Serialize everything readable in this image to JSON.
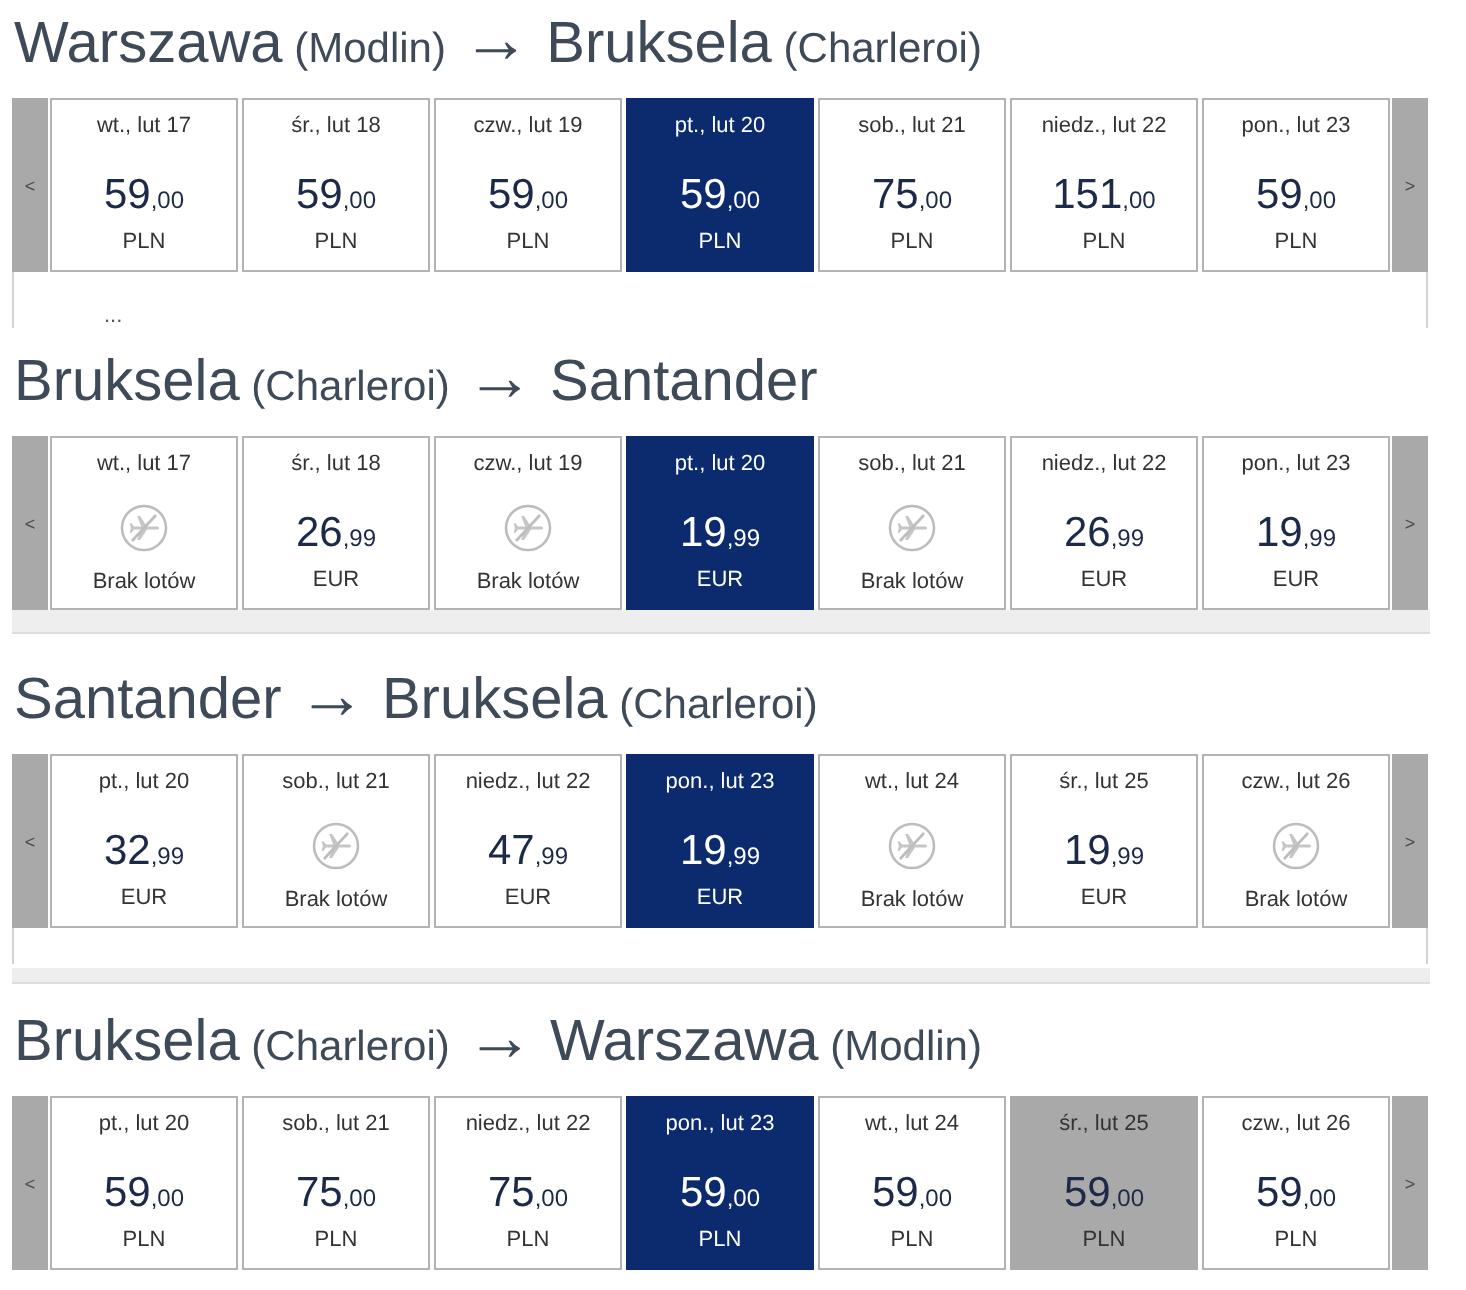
{
  "routes": [
    {
      "origin": "Warszawa",
      "origin_airport": "(Modlin)",
      "arrow": "→",
      "destination": "Bruksela",
      "destination_airport": "(Charleroi)",
      "prev": "<",
      "next": ">",
      "days": [
        {
          "kind": "fare",
          "date": "wt., lut 17",
          "price": "59",
          "decimals": ",00",
          "currency": "PLN",
          "selected": false,
          "greyed": false
        },
        {
          "kind": "fare",
          "date": "śr., lut 18",
          "price": "59",
          "decimals": ",00",
          "currency": "PLN",
          "selected": false,
          "greyed": false
        },
        {
          "kind": "fare",
          "date": "czw., lut 19",
          "price": "59",
          "decimals": ",00",
          "currency": "PLN",
          "selected": false,
          "greyed": false
        },
        {
          "kind": "fare",
          "date": "pt., lut 20",
          "price": "59",
          "decimals": ",00",
          "currency": "PLN",
          "selected": true,
          "greyed": false
        },
        {
          "kind": "fare",
          "date": "sob., lut 21",
          "price": "75",
          "decimals": ",00",
          "currency": "PLN",
          "selected": false,
          "greyed": false
        },
        {
          "kind": "fare",
          "date": "niedz., lut 22",
          "price": "151",
          "decimals": ",00",
          "currency": "PLN",
          "selected": false,
          "greyed": false
        },
        {
          "kind": "fare",
          "date": "pon., lut 23",
          "price": "59",
          "decimals": ",00",
          "currency": "PLN",
          "selected": false,
          "greyed": false
        }
      ],
      "note": "..."
    },
    {
      "origin": "Bruksela",
      "origin_airport": "(Charleroi)",
      "arrow": "→",
      "destination": "Santander",
      "prev": "<",
      "next": ">",
      "days": [
        {
          "kind": "no_flights",
          "date": "wt., lut 17",
          "label": "Brak lotów",
          "selected": false,
          "greyed": false
        },
        {
          "kind": "fare",
          "date": "śr., lut 18",
          "price": "26",
          "decimals": ",99",
          "currency": "EUR",
          "selected": false,
          "greyed": false
        },
        {
          "kind": "no_flights",
          "date": "czw., lut 19",
          "label": "Brak lotów",
          "selected": false,
          "greyed": false
        },
        {
          "kind": "fare",
          "date": "pt., lut 20",
          "price": "19",
          "decimals": ",99",
          "currency": "EUR",
          "selected": true,
          "greyed": false
        },
        {
          "kind": "no_flights",
          "date": "sob., lut 21",
          "label": "Brak lotów",
          "selected": false,
          "greyed": false
        },
        {
          "kind": "fare",
          "date": "niedz., lut 22",
          "price": "26",
          "decimals": ",99",
          "currency": "EUR",
          "selected": false,
          "greyed": false
        },
        {
          "kind": "fare",
          "date": "pon., lut 23",
          "price": "19",
          "decimals": ",99",
          "currency": "EUR",
          "selected": false,
          "greyed": false
        }
      ]
    },
    {
      "origin": "Santander",
      "arrow": "→",
      "destination": "Bruksela",
      "destination_airport": "(Charleroi)",
      "prev": "<",
      "next": ">",
      "days": [
        {
          "kind": "fare",
          "date": "pt., lut 20",
          "price": "32",
          "decimals": ",99",
          "currency": "EUR",
          "selected": false,
          "greyed": false
        },
        {
          "kind": "no_flights",
          "date": "sob., lut 21",
          "label": "Brak lotów",
          "selected": false,
          "greyed": false
        },
        {
          "kind": "fare",
          "date": "niedz., lut 22",
          "price": "47",
          "decimals": ",99",
          "currency": "EUR",
          "selected": false,
          "greyed": false
        },
        {
          "kind": "fare",
          "date": "pon., lut 23",
          "price": "19",
          "decimals": ",99",
          "currency": "EUR",
          "selected": true,
          "greyed": false
        },
        {
          "kind": "no_flights",
          "date": "wt., lut 24",
          "label": "Brak lotów",
          "selected": false,
          "greyed": false
        },
        {
          "kind": "fare",
          "date": "śr., lut 25",
          "price": "19",
          "decimals": ",99",
          "currency": "EUR",
          "selected": false,
          "greyed": false
        },
        {
          "kind": "no_flights",
          "date": "czw., lut 26",
          "label": "Brak lotów",
          "selected": false,
          "greyed": false
        }
      ]
    },
    {
      "origin": "Bruksela",
      "origin_airport": "(Charleroi)",
      "arrow": "→",
      "destination": "Warszawa",
      "destination_airport": "(Modlin)",
      "prev": "<",
      "next": ">",
      "days": [
        {
          "kind": "fare",
          "date": "pt., lut 20",
          "price": "59",
          "decimals": ",00",
          "currency": "PLN",
          "selected": false,
          "greyed": false
        },
        {
          "kind": "fare",
          "date": "sob., lut 21",
          "price": "75",
          "decimals": ",00",
          "currency": "PLN",
          "selected": false,
          "greyed": false
        },
        {
          "kind": "fare",
          "date": "niedz., lut 22",
          "price": "75",
          "decimals": ",00",
          "currency": "PLN",
          "selected": false,
          "greyed": false
        },
        {
          "kind": "fare",
          "date": "pon., lut 23",
          "price": "59",
          "decimals": ",00",
          "currency": "PLN",
          "selected": true,
          "greyed": false
        },
        {
          "kind": "fare",
          "date": "wt., lut 24",
          "price": "59",
          "decimals": ",00",
          "currency": "PLN",
          "selected": false,
          "greyed": false
        },
        {
          "kind": "fare",
          "date": "śr., lut 25",
          "price": "59",
          "decimals": ",00",
          "currency": "PLN",
          "selected": false,
          "greyed": true
        },
        {
          "kind": "fare",
          "date": "czw., lut 26",
          "price": "59",
          "decimals": ",00",
          "currency": "PLN",
          "selected": false,
          "greyed": false
        }
      ]
    }
  ]
}
